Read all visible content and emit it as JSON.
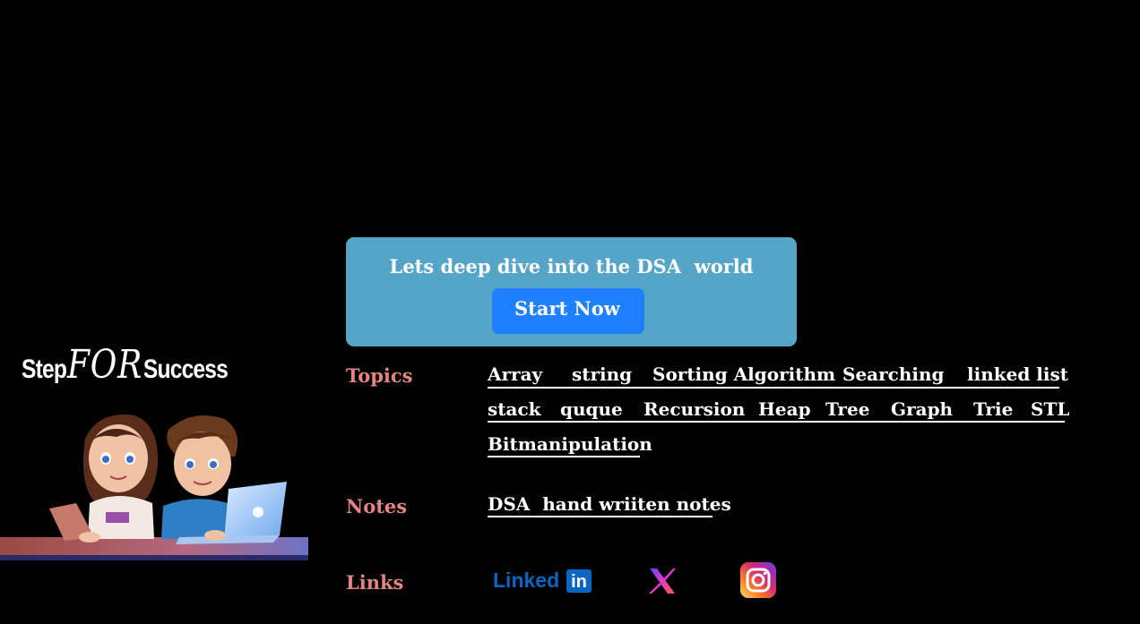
{
  "brand": {
    "step": "Step",
    "for": "FOR",
    "success": "Success"
  },
  "banner": {
    "text": "Lets deep dive into the DSA  world",
    "button": "Start Now"
  },
  "labels": {
    "topics": "Topics",
    "notes": "Notes",
    "links": "Links"
  },
  "topics": {
    "row1": [
      "Array",
      "string",
      "Sorting Algorithm",
      "Searching",
      "linked list"
    ],
    "row2": [
      "stack",
      "quque",
      "Recursion",
      "Heap",
      "Tree",
      "Graph",
      "Trie",
      "STL"
    ],
    "row3": [
      "Bitmanipulation"
    ]
  },
  "notes": {
    "link": "DSA  hand wriiten notes"
  },
  "links": {
    "linkedin": {
      "text": "Linked",
      "box": "in",
      "color": "#0a66c2"
    },
    "x": {
      "icon": "x-icon"
    },
    "instagram": {
      "icon": "instagram-icon"
    }
  }
}
